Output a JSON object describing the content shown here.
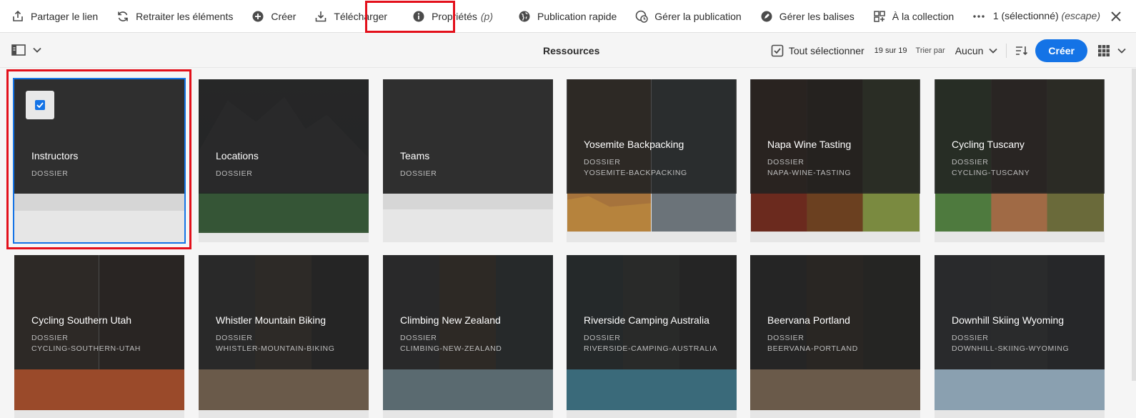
{
  "actionbar": {
    "items": [
      {
        "label": "Partager le lien",
        "icon": "share-icon"
      },
      {
        "label": "Retraiter les éléments",
        "icon": "refresh-icon"
      },
      {
        "label": "Créer",
        "icon": "add-circle-icon"
      },
      {
        "label": "Télécharger",
        "icon": "download-icon"
      },
      {
        "label": "Propriétés",
        "shortcut": "(p)",
        "icon": "info-icon"
      },
      {
        "label": "Publication rapide",
        "icon": "globe-icon"
      },
      {
        "label": "Gérer la publication",
        "icon": "globe-clock-icon"
      },
      {
        "label": "Gérer les balises",
        "icon": "tag-icon"
      },
      {
        "label": "À la collection",
        "icon": "collection-add-icon"
      }
    ],
    "selection_label": "1 (sélectionné)",
    "selection_hint": "(escape)"
  },
  "toolbar": {
    "title": "Ressources",
    "select_all": "Tout sélectionner",
    "count": "19 sur 19",
    "sort_label": "Trier par",
    "sort_value": "Aucun",
    "create": "Créer"
  },
  "cards": [
    {
      "title": "Instructors",
      "type": "DOSSIER",
      "slug": "",
      "selected": true
    },
    {
      "title": "Locations",
      "type": "DOSSIER",
      "slug": ""
    },
    {
      "title": "Teams",
      "type": "DOSSIER",
      "slug": ""
    },
    {
      "title": "Yosemite Backpacking",
      "type": "DOSSIER",
      "slug": "YOSEMITE-BACKPACKING"
    },
    {
      "title": "Napa Wine Tasting",
      "type": "DOSSIER",
      "slug": "NAPA-WINE-TASTING"
    },
    {
      "title": "Cycling Tuscany",
      "type": "DOSSIER",
      "slug": "CYCLING-TUSCANY"
    },
    {
      "title": "Cycling Southern Utah",
      "type": "DOSSIER",
      "slug": "CYCLING-SOUTHERN-UTAH"
    },
    {
      "title": "Whistler Mountain Biking",
      "type": "DOSSIER",
      "slug": "WHISTLER-MOUNTAIN-BIKING"
    },
    {
      "title": "Climbing New Zealand",
      "type": "DOSSIER",
      "slug": "CLIMBING-NEW-ZEALAND"
    },
    {
      "title": "Riverside Camping Australia",
      "type": "DOSSIER",
      "slug": "RIVERSIDE-CAMPING-AUSTRALIA"
    },
    {
      "title": "Beervana Portland",
      "type": "DOSSIER",
      "slug": "BEERVANA-PORTLAND"
    },
    {
      "title": "Downhill Skiing Wyoming",
      "type": "DOSSIER",
      "slug": "DOWNHILL-SKIING-WYOMING"
    }
  ],
  "colors": {
    "accent": "#1473e6",
    "highlight": "#e3101b"
  }
}
